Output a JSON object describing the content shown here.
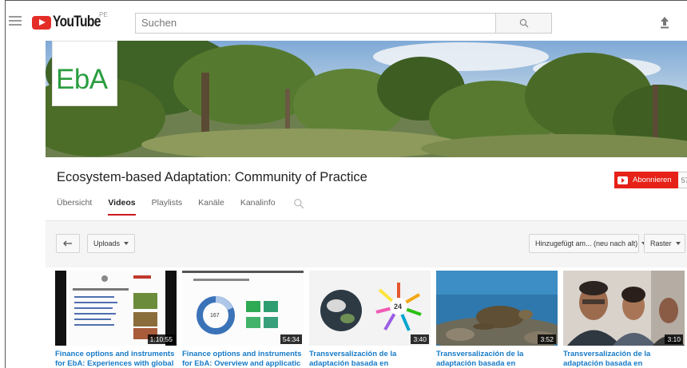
{
  "masthead": {
    "logo_text": "YouTube",
    "region": "PE",
    "search_placeholder": "Suchen"
  },
  "banner": {
    "avatar_text": "EbA"
  },
  "channel": {
    "title": "Ecosystem-based Adaptation: Community of Practice",
    "subscribe_label": "Abonnieren",
    "subscriber_count": "57"
  },
  "tabs": [
    {
      "label": "Übersicht",
      "active": false
    },
    {
      "label": "Videos",
      "active": true
    },
    {
      "label": "Playlists",
      "active": false
    },
    {
      "label": "Kanäle",
      "active": false
    },
    {
      "label": "Kanalinfo",
      "active": false
    }
  ],
  "filters": {
    "uploads_label": "Uploads",
    "sort_label": "Hinzugefügt am... (neu nach alt)",
    "view_label": "Raster"
  },
  "videos": [
    {
      "title": "Finance options and instruments for EbA: Experiences with global",
      "duration": "1:10:55"
    },
    {
      "title": "Finance options and instruments for EbA: Overview and applicatic",
      "duration": "54:34"
    },
    {
      "title": "Transversalización de la adaptación basada en",
      "duration": "3:40"
    },
    {
      "title": "Transversalización de la adaptación basada en",
      "duration": "3:52"
    },
    {
      "title": "Transversalización de la adaptación basada en",
      "duration": "3:10"
    }
  ],
  "colors": {
    "brand_red": "#e52d27",
    "link_blue": "#167ac6",
    "eba_green": "#2a9d3f"
  }
}
